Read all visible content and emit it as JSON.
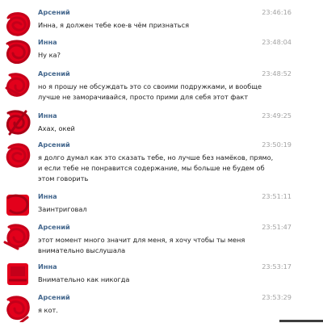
{
  "messages": [
    {
      "sender": "Арсений",
      "time": "23:46:16",
      "lines": [
        "Инна, я должен тебе кое-в чём признаться"
      ]
    },
    {
      "sender": "Инна",
      "time": "23:48:04",
      "lines": [
        "Ну ка?"
      ]
    },
    {
      "sender": "Арсений",
      "time": "23:48:52",
      "lines": [
        "но я прошу не обсуждать это со своими подружками, и вообще",
        "лучше не заморачивайся, просто прими для себя этот факт"
      ]
    },
    {
      "sender": "Инна",
      "time": "23:49:25",
      "lines": [
        "Ахах, окей"
      ]
    },
    {
      "sender": "Арсений",
      "time": "23:50:19",
      "lines": [
        "я долго думал как это сказать тебе, но лучше без намёков, прямо,",
        "и если тебе не понравится содержание, мы больше не будем об",
        "этом говорить"
      ]
    },
    {
      "sender": "Инна",
      "time": "23:51:11",
      "lines": [
        "Заинтриговал"
      ]
    },
    {
      "sender": "Арсений",
      "time": "23:51:47",
      "lines": [
        "этот момент много значит для меня, я хочу чтобы ты меня",
        "внимательно выслушала"
      ]
    },
    {
      "sender": "Инна",
      "time": "23:53:17",
      "lines": [
        "Внимательно как никогда"
      ]
    },
    {
      "sender": "Арсений",
      "time": "23:53:29",
      "lines": [
        "я кот."
      ]
    }
  ],
  "colors": {
    "sender": "#45688e",
    "time": "#a3a3a3",
    "text": "#222222",
    "redaction": "#e3001b"
  },
  "icons": {
    "avatar": "redacted-avatar-icon"
  }
}
